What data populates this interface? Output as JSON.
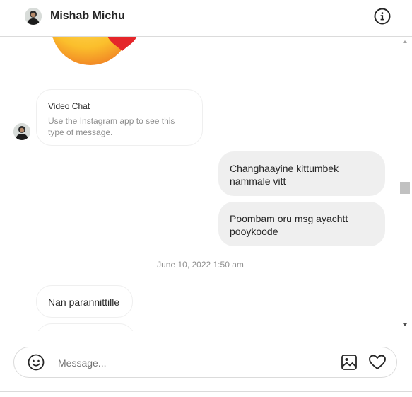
{
  "header": {
    "name": "Mishab Michu",
    "avatar_icon": "profile-avatar",
    "info_icon": "info-icon"
  },
  "thread": {
    "system_message": {
      "title": "Video Chat",
      "subtitle": "Use the Instagram app to see this type of message."
    },
    "outgoing": [
      "Changhaayine kittumbek nammale vitt",
      "Poombam oru msg ayachtt pooykoode"
    ],
    "timestamp": "June 10, 2022 1:50 am",
    "incoming": [
      "Nan parannittille"
    ]
  },
  "composer": {
    "placeholder": "Message...",
    "emoji_icon": "smiley-icon",
    "image_icon": "image-icon",
    "like_icon": "heart-icon"
  },
  "colors": {
    "bubble_out": "#efefef",
    "border": "#dbdbdb",
    "muted_text": "#8e8e8e"
  }
}
